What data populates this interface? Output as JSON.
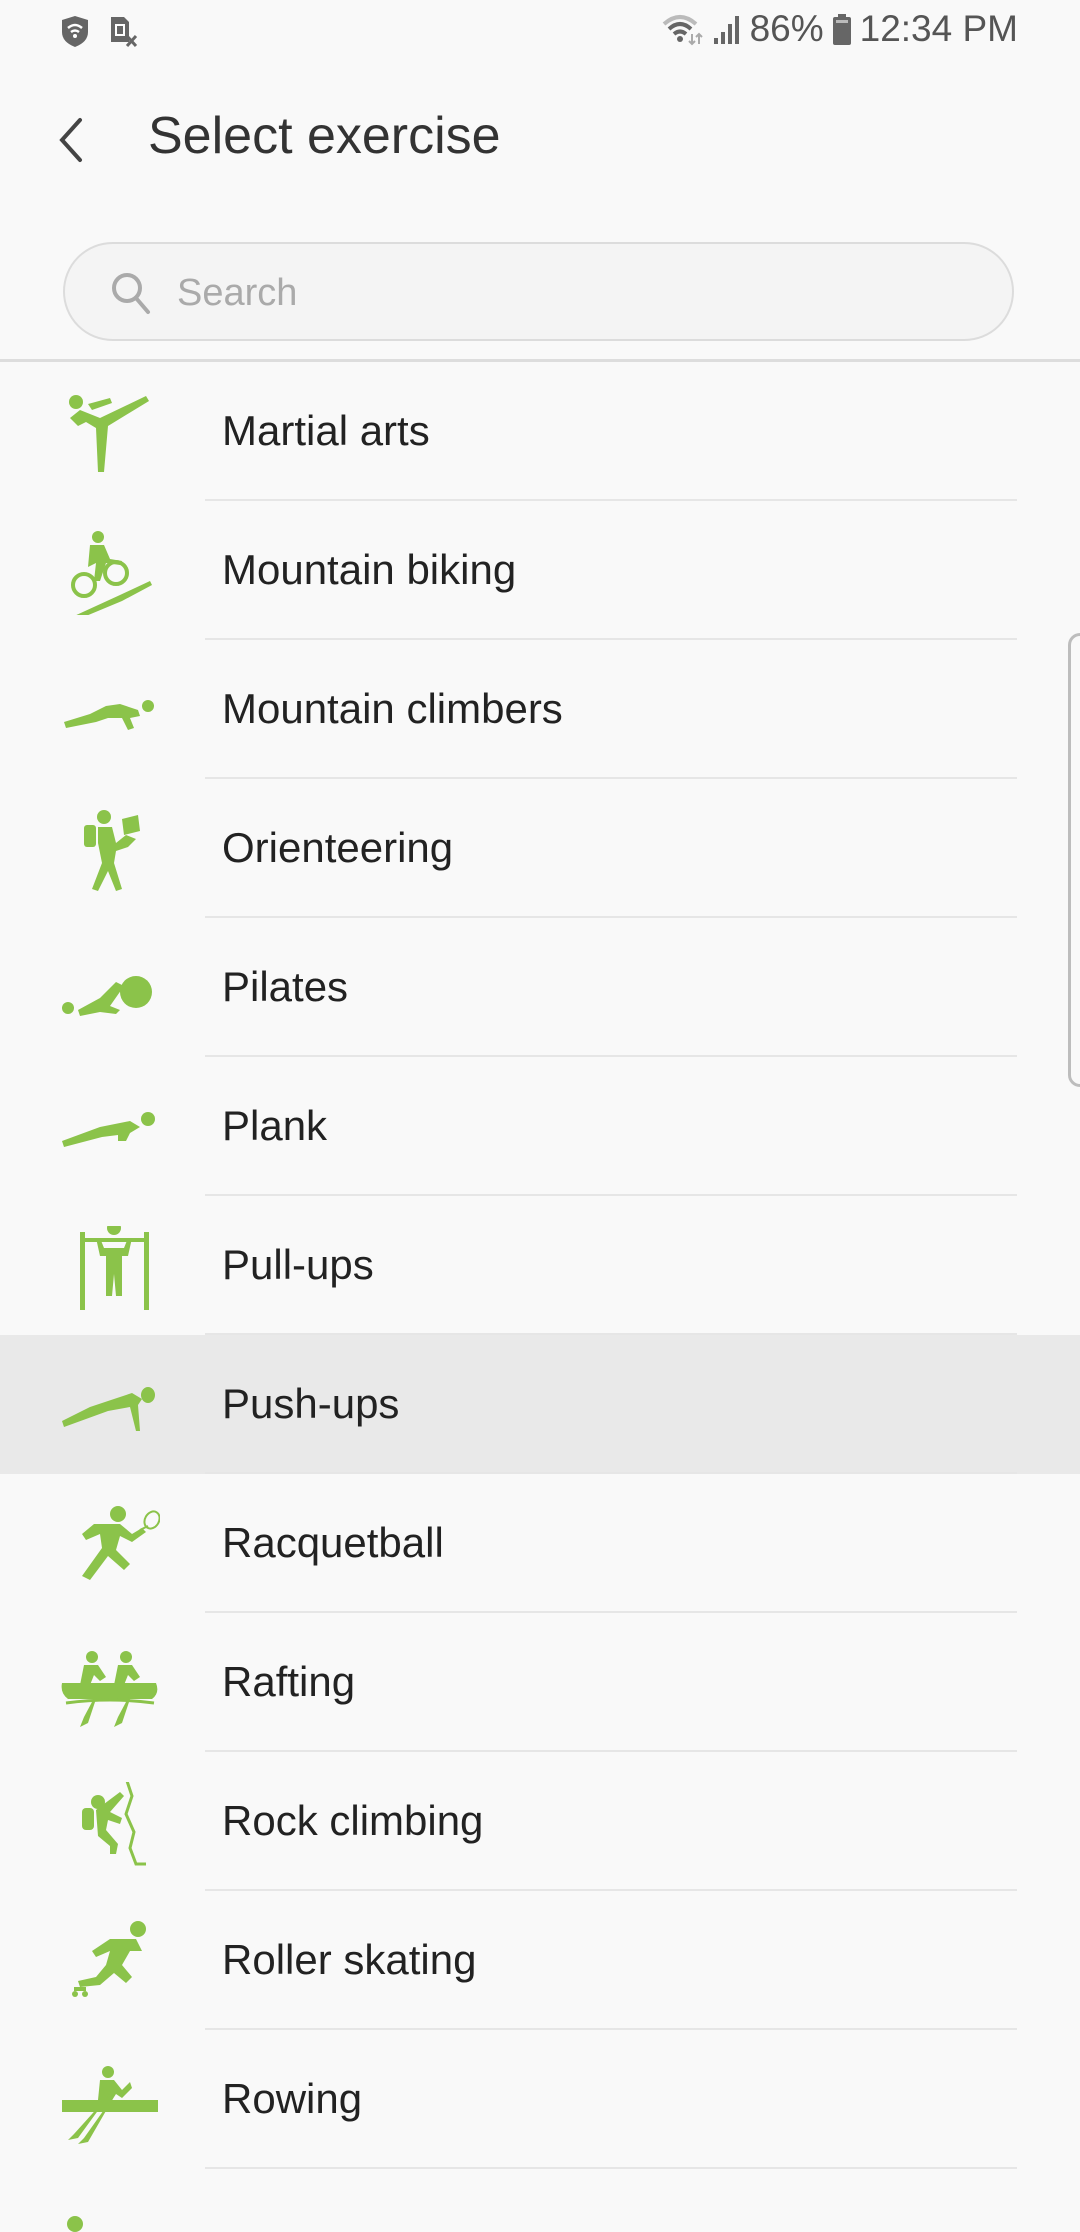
{
  "status_bar": {
    "left_icons": [
      "wifi-shield-icon",
      "sim-card-off-icon"
    ],
    "right_icons": [
      "wifi-icon",
      "signal-icon"
    ],
    "battery_percent": "86%",
    "time": "12:34 PM"
  },
  "header": {
    "back_icon": "chevron-left-icon",
    "title": "Select exercise"
  },
  "search": {
    "placeholder": "Search",
    "value": ""
  },
  "accent_color": "#8bc34a",
  "list": {
    "items": [
      {
        "label": "Martial arts",
        "icon": "martial-arts-icon"
      },
      {
        "label": "Mountain biking",
        "icon": "mountain-biking-icon"
      },
      {
        "label": "Mountain climbers",
        "icon": "mountain-climbers-icon"
      },
      {
        "label": "Orienteering",
        "icon": "orienteering-icon"
      },
      {
        "label": "Pilates",
        "icon": "pilates-icon"
      },
      {
        "label": "Plank",
        "icon": "plank-icon"
      },
      {
        "label": "Pull-ups",
        "icon": "pull-ups-icon"
      },
      {
        "label": "Push-ups",
        "icon": "push-ups-icon",
        "selected": true
      },
      {
        "label": "Racquetball",
        "icon": "racquetball-icon"
      },
      {
        "label": "Rafting",
        "icon": "rafting-icon"
      },
      {
        "label": "Rock climbing",
        "icon": "rock-climbing-icon"
      },
      {
        "label": "Roller skating",
        "icon": "roller-skating-icon"
      },
      {
        "label": "Rowing",
        "icon": "rowing-icon"
      }
    ]
  }
}
